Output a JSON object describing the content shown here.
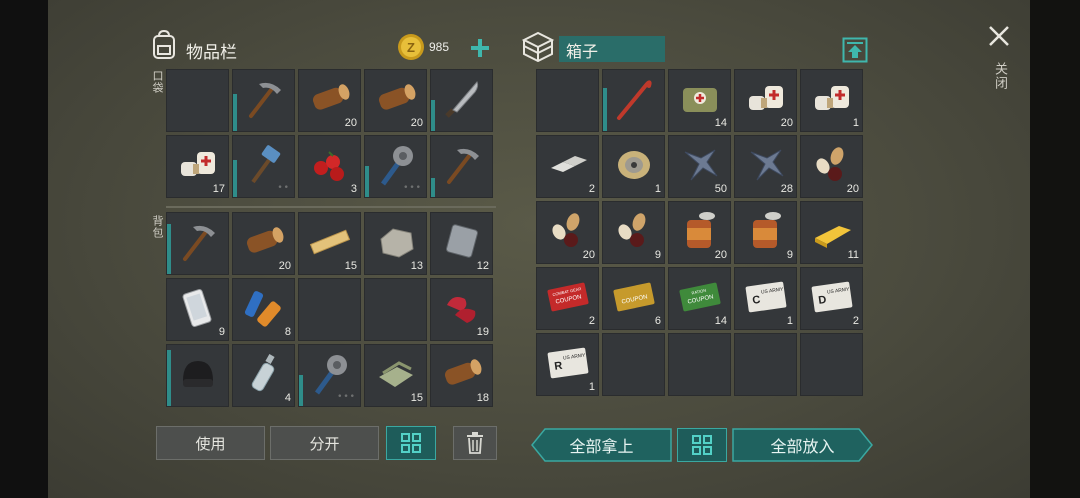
{
  "header": {
    "inventory_title": "物品栏",
    "coins": "985",
    "container_title": "箱子",
    "close_label": "关闭"
  },
  "labels": {
    "pockets": "口袋",
    "backpack": "背包"
  },
  "pockets": [
    {
      "icon": "",
      "count": "",
      "dura": 0,
      "dots": ""
    },
    {
      "icon": "pickaxe-icon",
      "count": "",
      "dura": 0.6,
      "dots": ""
    },
    {
      "icon": "log-icon",
      "count": "20",
      "dura": 0,
      "dots": ""
    },
    {
      "icon": "log-icon",
      "count": "20",
      "dura": 0,
      "dots": ""
    },
    {
      "icon": "machete-icon",
      "count": "",
      "dura": 0.5,
      "dots": ""
    },
    {
      "icon": "bandage-icon",
      "count": "17",
      "dura": 0,
      "dots": ""
    },
    {
      "icon": "hammer-icon",
      "count": "",
      "dura": 0.6,
      "dots": "••"
    },
    {
      "icon": "berries-icon",
      "count": "3",
      "dura": 0,
      "dots": ""
    },
    {
      "icon": "saw-club-icon",
      "count": "",
      "dura": 0.5,
      "dots": "•••"
    },
    {
      "icon": "pickaxe-icon",
      "count": "",
      "dura": 0.3,
      "dots": ""
    }
  ],
  "backpack": [
    {
      "icon": "pickaxe-icon",
      "count": "",
      "dura": 0.8,
      "dots": ""
    },
    {
      "icon": "log-icon",
      "count": "20",
      "dura": 0,
      "dots": ""
    },
    {
      "icon": "plank-icon",
      "count": "15",
      "dura": 0,
      "dots": ""
    },
    {
      "icon": "stone-icon",
      "count": "13",
      "dura": 0,
      "dots": ""
    },
    {
      "icon": "metal-plate-icon",
      "count": "12",
      "dura": 0,
      "dots": ""
    },
    {
      "icon": "phone-icon",
      "count": "9",
      "dura": 0,
      "dots": ""
    },
    {
      "icon": "battery-icon",
      "count": "8",
      "dura": 0,
      "dots": ""
    },
    {
      "icon": "",
      "count": "",
      "dura": 0,
      "dots": ""
    },
    {
      "icon": "",
      "count": "",
      "dura": 0,
      "dots": ""
    },
    {
      "icon": "raw-meat-icon",
      "count": "19",
      "dura": 0,
      "dots": ""
    },
    {
      "icon": "beanie-icon",
      "count": "",
      "dura": 0.9,
      "dots": ""
    },
    {
      "icon": "bottle-icon",
      "count": "4",
      "dura": 0,
      "dots": ""
    },
    {
      "icon": "saw-club-icon",
      "count": "",
      "dura": 0.5,
      "dots": "•••"
    },
    {
      "icon": "cloth-icon",
      "count": "15",
      "dura": 0,
      "dots": ""
    },
    {
      "icon": "log-icon",
      "count": "18",
      "dura": 0,
      "dots": ""
    }
  ],
  "box": [
    {
      "icon": "",
      "count": "",
      "dura": 0,
      "dots": ""
    },
    {
      "icon": "crowbar-icon",
      "count": "",
      "dura": 0.7,
      "dots": ""
    },
    {
      "icon": "medkit-icon",
      "count": "14",
      "dura": 0,
      "dots": ""
    },
    {
      "icon": "bandage-icon",
      "count": "20",
      "dura": 0,
      "dots": ""
    },
    {
      "icon": "bandage-icon",
      "count": "1",
      "dura": 0,
      "dots": ""
    },
    {
      "icon": "ingot-icon",
      "count": "2",
      "dura": 0,
      "dots": ""
    },
    {
      "icon": "wire-spool-icon",
      "count": "1",
      "dura": 0,
      "dots": ""
    },
    {
      "icon": "scrap-icon",
      "count": "50",
      "dura": 0,
      "dots": ""
    },
    {
      "icon": "scrap-icon",
      "count": "28",
      "dura": 0,
      "dots": ""
    },
    {
      "icon": "seeds-icon",
      "count": "20",
      "dura": 0,
      "dots": ""
    },
    {
      "icon": "seeds-icon",
      "count": "20",
      "dura": 0,
      "dots": ""
    },
    {
      "icon": "seeds-icon",
      "count": "9",
      "dura": 0,
      "dots": ""
    },
    {
      "icon": "tin-can-icon",
      "count": "20",
      "dura": 0,
      "dots": ""
    },
    {
      "icon": "tin-can-icon",
      "count": "9",
      "dura": 0,
      "dots": ""
    },
    {
      "icon": "gold-bar-icon",
      "count": "11",
      "dura": 0,
      "dots": ""
    },
    {
      "icon": "coupon-icon",
      "count": "2",
      "dura": 0,
      "dots": "",
      "color": "#c42a2a",
      "text": "COUPON",
      "sub": "COMBAT GEAR"
    },
    {
      "icon": "coupon-icon",
      "count": "6",
      "dura": 0,
      "dots": "",
      "color": "#c69a2c",
      "text": "COUPON",
      "sub": ""
    },
    {
      "icon": "coupon-icon",
      "count": "14",
      "dura": 0,
      "dots": "",
      "color": "#3f8a3b",
      "text": "COUPON",
      "sub": "RATION"
    },
    {
      "icon": "army-card-icon",
      "count": "1",
      "dura": 0,
      "dots": "",
      "letter": "C",
      "text": "US ARMY"
    },
    {
      "icon": "army-card-icon",
      "count": "2",
      "dura": 0,
      "dots": "",
      "letter": "D",
      "text": "US ARMY"
    },
    {
      "icon": "army-card-icon",
      "count": "1",
      "dura": 0,
      "dots": "",
      "letter": "R",
      "text": "US ARMY"
    },
    {
      "icon": "",
      "count": "",
      "dura": 0,
      "dots": ""
    },
    {
      "icon": "",
      "count": "",
      "dura": 0,
      "dots": ""
    },
    {
      "icon": "",
      "count": "",
      "dura": 0,
      "dots": ""
    },
    {
      "icon": "",
      "count": "",
      "dura": 0,
      "dots": ""
    }
  ],
  "buttons": {
    "use": "使用",
    "split": "分开",
    "take_all": "全部拿上",
    "put_all": "全部放入"
  },
  "colors": {
    "accent": "#3aa8a1",
    "slot": "#34373a",
    "durability": "#2f8d8a"
  }
}
